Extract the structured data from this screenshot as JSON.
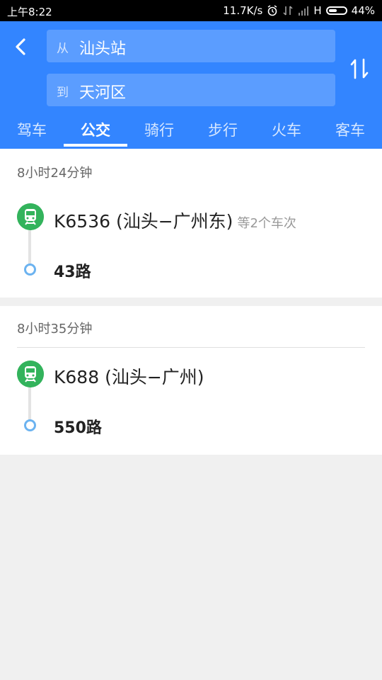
{
  "status_bar": {
    "time": "上午8:22",
    "speed": "11.7K/s",
    "network": "H",
    "battery": "44%"
  },
  "search": {
    "from_label": "从",
    "from_value": "汕头站",
    "to_label": "到",
    "to_value": "天河区"
  },
  "tabs": [
    "驾车",
    "公交",
    "骑行",
    "步行",
    "火车",
    "客车"
  ],
  "active_tab": "公交",
  "results": [
    {
      "duration": "8小时24分钟",
      "train": "K6536",
      "train_route": "(汕头−广州东)",
      "extra": "等2个车次",
      "bus": "43路"
    },
    {
      "duration": "8小时35分钟",
      "train": "K688",
      "train_route": "(汕头−广州)",
      "extra": "",
      "bus": "550路"
    }
  ],
  "colors": {
    "header_bg": "#3385ff",
    "train_icon": "#33b35c",
    "bus_dot": "#6cb3f0"
  }
}
